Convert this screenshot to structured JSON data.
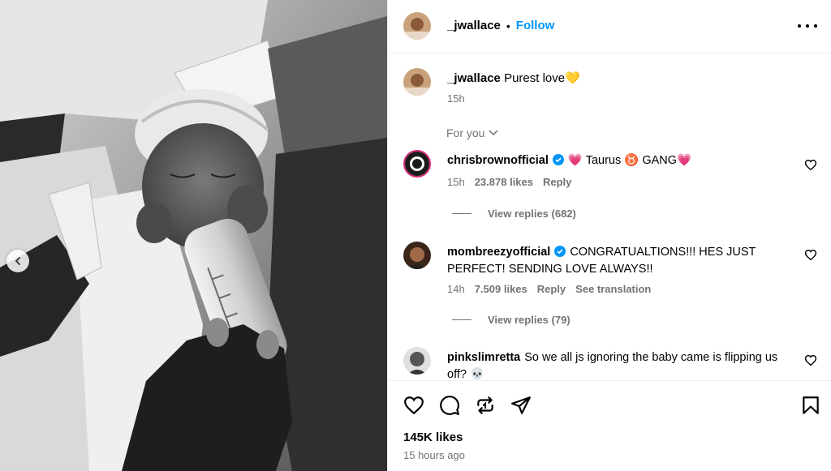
{
  "post": {
    "author": "_jwallace",
    "follow_label": "Follow",
    "separator": "•",
    "photo_alt": "post-photo"
  },
  "caption": {
    "username": "_jwallace",
    "text": "Purest love",
    "emoji": "💛",
    "time": "15h"
  },
  "for_you_label": "For you",
  "comments": [
    {
      "username": "chrisbrownofficial",
      "verified": true,
      "text": "💗 Taurus ♉️ GANG💗",
      "time": "15h",
      "likes": "23.878 likes",
      "reply_label": "Reply",
      "view_replies": "View replies (682)"
    },
    {
      "username": "mombreezyofficial",
      "verified": true,
      "text": "CONGRATUALTIONS!!! HES JUST PERFECT! SENDING LOVE ALWAYS!!",
      "time": "14h",
      "likes": "7.509 likes",
      "reply_label": "Reply",
      "translation_label": "See translation",
      "view_replies": "View replies (79)"
    },
    {
      "username": "pinkslimretta",
      "verified": false,
      "text": "So we all js ignoring the baby came is flipping us off? 💀"
    }
  ],
  "footer": {
    "likes": "145K likes",
    "ago": "15 hours ago"
  },
  "icons": {
    "like": "heart-icon",
    "comment": "comment-icon",
    "share": "repost-icon",
    "send": "send-icon",
    "save": "bookmark-icon",
    "more": "more-icon",
    "verified": "verified-badge-icon",
    "prev": "chevron-left-icon"
  },
  "colors": {
    "link": "#0095f6",
    "secondary_text": "#737373",
    "verified": "#0095f6",
    "divider": "#efefef"
  }
}
